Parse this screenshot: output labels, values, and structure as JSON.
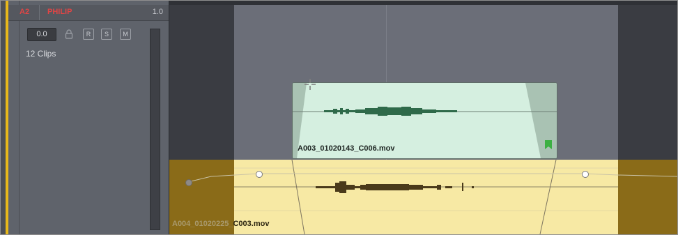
{
  "track_header": {
    "track_id": "A2",
    "track_name": "PHILIP",
    "track_number": "1.0",
    "volume": "0.0",
    "buttons": {
      "record": "R",
      "solo": "S",
      "mute": "M"
    },
    "clip_count": "12 Clips"
  },
  "timeline": {
    "video_clip": {
      "name": "A003_01020143_C006.mov"
    },
    "audio_clip": {
      "name_prefix": "A004_01020225_",
      "name_suffix": "C003.mov"
    }
  },
  "colors": {
    "track_label": "#e04545",
    "track_color_strip": "#e8b81a",
    "video_clip_fill": "#d5efe0",
    "audio_clip_fill": "#f7e9a4",
    "waveform_video": "#2f6a4a",
    "waveform_audio": "#4a3a1a",
    "marker": "#3cb043"
  },
  "icons": {
    "lock": "lock-icon",
    "cursor": "crosshair-cursor-icon",
    "marker": "flag-marker-icon"
  }
}
